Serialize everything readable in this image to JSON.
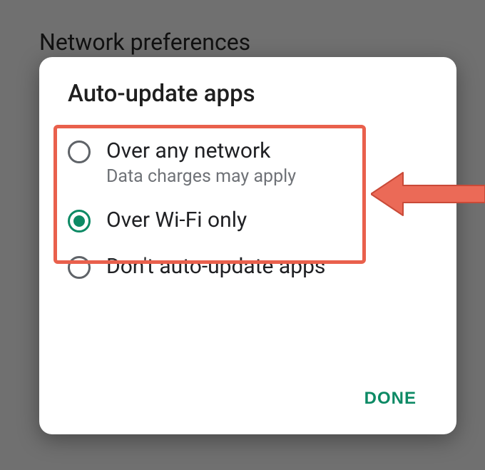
{
  "background": {
    "title": "Network preferences"
  },
  "dialog": {
    "title": "Auto-update apps",
    "options": [
      {
        "label": "Over any network",
        "sub": "Data charges may apply",
        "selected": false
      },
      {
        "label": "Over Wi-Fi only",
        "sub": "",
        "selected": true
      },
      {
        "label": "Don't auto-update apps",
        "sub": "",
        "selected": false
      }
    ],
    "done_label": "DONE"
  },
  "annotation": {
    "highlight": "highlighted-options",
    "arrow": "pointer-arrow"
  },
  "colors": {
    "accent": "#0d8a65",
    "highlight": "#e9604c",
    "bg": "#707070"
  }
}
